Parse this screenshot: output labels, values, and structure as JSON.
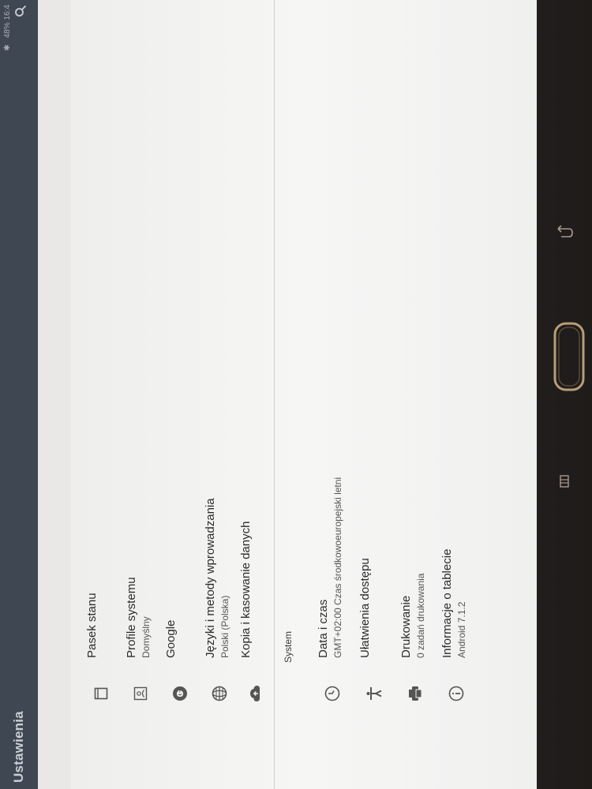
{
  "app": {
    "title": "Ustawienia"
  },
  "statusbar": {
    "text": "48% 16:4"
  },
  "items": [
    {
      "title": "Pasek stanu",
      "subtitle": "",
      "icon": "square-icon"
    },
    {
      "title": "Profile systemu",
      "subtitle": "Domyślny",
      "icon": "profile-icon"
    },
    {
      "title": "Google",
      "subtitle": "",
      "icon": "google-icon"
    },
    {
      "title": "Języki i metody wprowadzania",
      "subtitle": "Polski (Polska)",
      "icon": "globe-icon"
    },
    {
      "title": "Kopia i kasowanie danych",
      "subtitle": "",
      "icon": "cloud-icon"
    }
  ],
  "system": {
    "label": "System",
    "items": [
      {
        "title": "Data i czas",
        "subtitle": "GMT+02:00 Czas środkowoeuropejski letni",
        "icon": "clock-icon"
      },
      {
        "title": "Ułatwienia dostępu",
        "subtitle": "",
        "icon": "accessibility-icon"
      },
      {
        "title": "Drukowanie",
        "subtitle": "0 zadań drukowania",
        "icon": "printer-icon"
      },
      {
        "title": "Informacje o tablecie",
        "subtitle": "Android 7.1.2",
        "icon": "info-icon"
      }
    ]
  }
}
